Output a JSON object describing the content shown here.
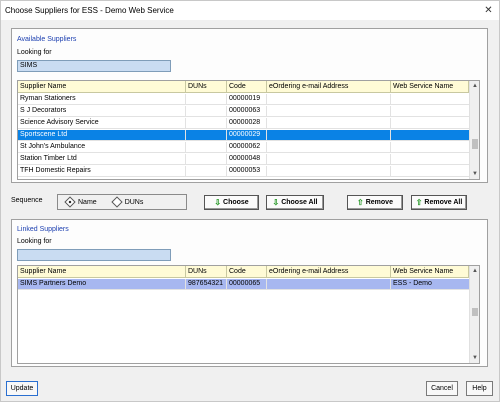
{
  "window": {
    "title": "Choose Suppliers for ESS - Demo Web Service",
    "close_glyph": "✕"
  },
  "available": {
    "group_label": "Available Suppliers",
    "looking_for_label": "Looking for",
    "search_value": "SIMS",
    "columns": [
      "Supplier Name",
      "DUNs",
      "Code",
      "eOrdering e-mail Address",
      "Web Service Name"
    ],
    "rows": [
      {
        "name": "Ryman Stationers",
        "duns": "",
        "code": "00000019",
        "email": "",
        "service": ""
      },
      {
        "name": "S J Decorators",
        "duns": "",
        "code": "00000063",
        "email": "",
        "service": ""
      },
      {
        "name": "Science Advisory Service",
        "duns": "",
        "code": "00000028",
        "email": "",
        "service": ""
      },
      {
        "name": "Sportscene Ltd",
        "duns": "",
        "code": "00000029",
        "email": "",
        "service": ""
      },
      {
        "name": "St John's Ambulance",
        "duns": "",
        "code": "00000062",
        "email": "",
        "service": ""
      },
      {
        "name": "Station Timber Ltd",
        "duns": "",
        "code": "00000048",
        "email": "",
        "service": ""
      },
      {
        "name": "TFH Domestic Repairs",
        "duns": "",
        "code": "00000053",
        "email": "",
        "service": ""
      }
    ],
    "selected_row": "Sportscene Ltd"
  },
  "sequence": {
    "label": "Sequence",
    "options": [
      {
        "label": "Name",
        "selected": true
      },
      {
        "label": "DUNs",
        "selected": false
      }
    ]
  },
  "actions": {
    "choose": "Choose",
    "choose_all": "Choose All",
    "remove": "Remove",
    "remove_all": "Remove All",
    "down_arrow_icon": "down-arrow-icon",
    "up_arrow_icon": "up-arrow-icon",
    "icon_color": "#2a9a2a"
  },
  "linked": {
    "group_label": "Linked Suppliers",
    "looking_for_label": "Looking for",
    "search_value": "",
    "columns": [
      "Supplier Name",
      "DUNs",
      "Code",
      "eOrdering e-mail Address",
      "Web Service Name"
    ],
    "rows": [
      {
        "name": "SIMS Partners Demo",
        "duns": "987654321",
        "code": "00000065",
        "email": "",
        "service": "ESS - Demo"
      }
    ]
  },
  "footer": {
    "update": "Update",
    "cancel": "Cancel",
    "help": "Help"
  },
  "colors": {
    "selected_row": "#0a82e5",
    "linked_row": "#a7b7f0",
    "header_bg": "#fffbd6",
    "search_bg": "#c9dcf2",
    "group_label": "#1c3fb0"
  }
}
